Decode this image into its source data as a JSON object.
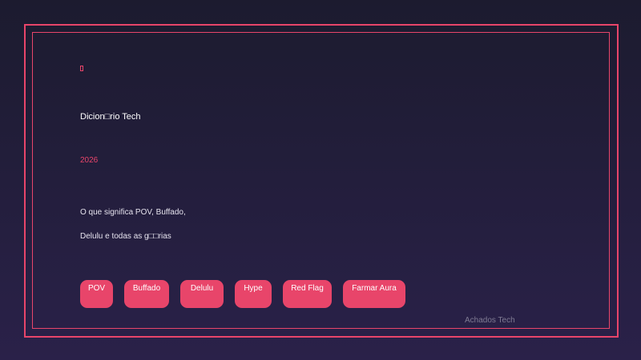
{
  "card": {
    "icon": "sparkle-icon",
    "title": "Dicion□rio Tech",
    "year": "2026",
    "description_line1": "O que significa POV, Buffado,",
    "description_line2": "Delulu e todas as g□□rias",
    "tags": [
      "POV",
      "Buffado",
      "Delulu",
      "Hype",
      "Red Flag",
      "Farmar Aura"
    ],
    "brand": "Achados Tech"
  },
  "colors": {
    "accent": "#e8456a",
    "background_top": "#1c1b2f",
    "background_bottom": "#2a2149",
    "muted_text": "#7f7b93"
  }
}
